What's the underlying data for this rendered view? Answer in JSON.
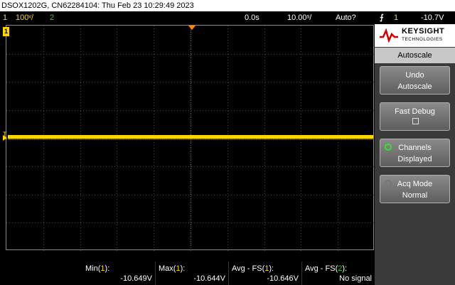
{
  "title_bar": {
    "text": "DSOX1202G, CN62284104: Thu Feb 23 10:29:49 2023"
  },
  "status": {
    "ch1_num": "1",
    "ch1_scale": "100ᵛ/",
    "ch2_num": "2",
    "time_delay": "0.0s",
    "time_scale": "10.00ˢ/",
    "trigger_mode": "Auto?",
    "trigger_symbol": "⨍",
    "trigger_source": "1",
    "trigger_level": "-10.7V"
  },
  "screen": {
    "ch1_marker": "1",
    "trigger_level_marker": "T",
    "colors": {
      "ch1": "#ffd700",
      "ch2": "#36c72e",
      "grid": "#555555",
      "trigger_marker": "#ff8c00"
    }
  },
  "panel": {
    "brand": "KEYSIGHT",
    "brand_sub": "TECHNOLOGIES",
    "menu_title": "Autoscale",
    "softkeys": [
      {
        "line1": "Undo",
        "line2": "Autoscale"
      },
      {
        "line1": "Fast Debug",
        "line2": ""
      },
      {
        "line1": "Channels",
        "line2": "Displayed"
      },
      {
        "line1": "Acq Mode",
        "line2": "Normal"
      }
    ]
  },
  "measurements": [
    {
      "label_prefix": "Min(",
      "src": "1",
      "label_suffix": "):",
      "value": "-10.649V"
    },
    {
      "label_prefix": "Max(",
      "src": "1",
      "label_suffix": "):",
      "value": "-10.644V"
    },
    {
      "label_prefix": "Avg - FS(",
      "src": "1",
      "label_suffix": "):",
      "value": "-10.646V"
    },
    {
      "label_prefix": "Avg - FS(",
      "src": "2",
      "label_suffix": "):",
      "value": "No signal"
    }
  ]
}
